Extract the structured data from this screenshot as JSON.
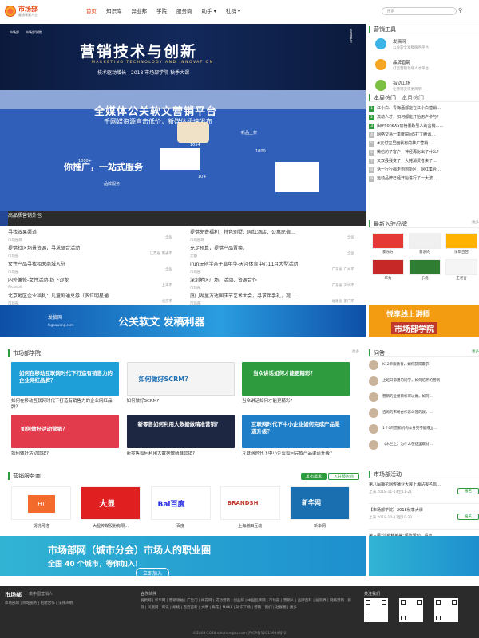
{
  "header": {
    "logo_main": "市场部",
    "logo_sub": "營銷專業人士",
    "tagline": "做中国",
    "nav": [
      "首页",
      "知识库",
      "异业邦",
      "学院",
      "服务商",
      "助手 ▾",
      "社群 ▾"
    ],
    "search_placeholder": "搜索",
    "search_icon": "search-icon"
  },
  "hero": {
    "title": "营销技术与创新",
    "subtitle": "MARKETING TECHNOLOGY AND INNOVATION",
    "line": "技术驱动增长　2018 市场部学院 秋季大课",
    "badge_left": "市场部",
    "badge_left2": "市场部学院",
    "badge_right": "市场部学院"
  },
  "slider": {
    "headline": "全媒体公关软文营销平台",
    "sub": "千网媒资源直击低价，新媒体极速发布",
    "headline2": "你推广，一站式服务",
    "footer": "高品质营销外包",
    "labels": [
      "1000+",
      "1054",
      "1000",
      "新品上架",
      "10+",
      "品牌服务"
    ]
  },
  "news": [
    {
      "t": "寻找效果渠道",
      "m": "市场部网",
      "p": "全国",
      "t2": "提供免费福利：特色别墅、网红酒店、公寓民宿…",
      "m2": "市场部网",
      "p2": "全国"
    },
    {
      "t": "提供社区场景资源，寻求联合活动",
      "m": "市场部",
      "p": "江苏省 南通市",
      "t2": "充足预算，提供产品置换。",
      "m2": "大都",
      "p2": "全国"
    },
    {
      "t": "女性产品寻找相关商城入驻",
      "m": "市场部",
      "p": "全国",
      "t2": "ifun玩创学亲子嘉年华-天河体育中心11月大型活动",
      "m2": "市场部",
      "p2": "广东省 广州市"
    },
    {
      "t": "内外兼修-女性活动-线下沙龙",
      "m": "Ricosoft",
      "p": "上海市",
      "t2": "深圳地区广场、活动、资源合作",
      "m2": "市场部",
      "p2": "广东省 深圳市"
    },
    {
      "t": "北京地区企业福利：儿童剧通兑券（多位明星通…",
      "m": "市场部",
      "p": "北京市",
      "t2": "厦门湖里方达国庆节艺术大会，寻求伴手礼，提…",
      "m2": "市场部",
      "p2": "福建省 厦门市"
    }
  ],
  "banner1": {
    "logo": "发稿网",
    "logo_url": "fagaowang.com",
    "text": "公关软文 发稿利器"
  },
  "academy": {
    "title": "市场部学院",
    "more": "更多",
    "items": [
      {
        "img": "如何在移动互联网时代下打造有销售力的企业网红品牌？",
        "t": "如何在移动互联网时代下打造有销售力的企业网红品牌？"
      },
      {
        "img": "如何做好SCRM？",
        "t": "如何做好SCRM?"
      },
      {
        "img": "当众讲话如何才能更精彩？",
        "t": "当众讲话如何才能更精彩?"
      },
      {
        "img": "如何做好活动营销？",
        "t": "如何做好活动营销?"
      },
      {
        "img": "新零售如何利用大数据做精准营销？",
        "t": "新零售如何利用大数据做精准营销?"
      },
      {
        "img": "互联网时代下中小企业如何完成产品渠道升级？",
        "t": "互联网时代下中小企业如何完成产品渠道升级?"
      }
    ]
  },
  "services": {
    "title": "营销服务商",
    "btn1": "发布需求",
    "btn2": "入驻服务商",
    "items": [
      {
        "n": "胡桃网络",
        "logo": "HT"
      },
      {
        "n": "大显传媒股份有限…",
        "logo": "大显"
      },
      {
        "n": "百度",
        "logo": "Bai百度"
      },
      {
        "n": "上海增田互动",
        "logo": "BRANDSH"
      },
      {
        "n": "新华网",
        "logo": "新华网"
      }
    ]
  },
  "banner2": {
    "title": "市场部网（城市分会）市场人的职业圈",
    "sub": "全国 40 个城市，等你加入！",
    "join": "立即加入"
  },
  "right": {
    "tools_title": "营销工具",
    "tools": [
      {
        "n": "发稿网",
        "d": "公关软文发稿服务平台",
        "c": "#3cb4e8"
      },
      {
        "n": "品牌直聘",
        "d": "打造营销领域人才平台",
        "c": "#f5a623"
      },
      {
        "n": "指动工场",
        "d": "让营销变得更简单",
        "c": "#7bc043"
      }
    ],
    "hot_tabs": [
      "本周热门",
      "本月热门"
    ],
    "hot": [
      {
        "n": "1",
        "t": "江小白、青梅酒都能在江小白营销…"
      },
      {
        "n": "2",
        "t": "流动人才，如何都能开始用户参与？"
      },
      {
        "n": "3",
        "t": "由iPhoneXS价格暴跌引人的营销……"
      },
      {
        "n": "4",
        "t": "网络交易一季度瞬间5打了腾讯…"
      },
      {
        "n": "5",
        "t": "#支付宝里面就有的推广营销…"
      },
      {
        "n": "6",
        "t": "微信的了客户，神经再比出了什么？"
      },
      {
        "n": "7",
        "t": "又双叒叕变了！大摊消费者来了…"
      },
      {
        "n": "8",
        "t": "话一行行都走到到新区：网红集合…"
      },
      {
        "n": "9",
        "t": "运动品牌已经开始进行了一大波…"
      }
    ],
    "partners_title": "最新入驻品牌",
    "more": "更多",
    "partners": [
      "新东方",
      "新浪的",
      "深圳百合",
      "华为",
      "乐视",
      "王老吉",
      "德克士",
      "CITEEN",
      "LEFIT",
      "小猪侠",
      "HICP",
      "真品牌"
    ],
    "promo": {
      "t1": "悦享线上讲师",
      "t2": "市场部学院"
    },
    "qa_title": "问答",
    "qa": [
      "K12单跟教育，如何获得需求",
      "上班日常用的同学，如何培养的营销",
      "营销的业绩目标可以做，如何…",
      "咨询的市场合作怎么签的就，…",
      "1个0的营销机构本身完不能成立…",
      "《木兰之》为什么在这里取材…",
      "求K12教育市场招商…"
    ],
    "ev_title": "市场部活动",
    "events": [
      {
        "t": "第八届梅花网传播业大展上海站报名启…",
        "d": "上海 2018-11-14至11-21",
        "b": "报名"
      },
      {
        "t": "【市场部学院】2018秋季大课",
        "d": "上海 2018-10-13至10-30",
        "b": "报名"
      },
      {
        "t": "第三届\"营销精英荟\"评选活动，看市…",
        "d": "上海 2018-08-01至09-30",
        "b": "报名"
      }
    ]
  },
  "footer": {
    "logo": "市场部",
    "logo_sub": "做中国营销人",
    "links": "关于我们 | 联系我们 | 免责声明",
    "links2": "市场部网 | 网站服务 | 招聘合作 | 法律声明",
    "partner_title": "合作伙伴",
    "partners": "发稿网 | 新华网 | 营销领袖 | 广告门 | 梅花网 | 成功营销 | 创业邦 | 中国品牌网 | 市场部 | 营销人 | 品牌百科 | 投资界 | 网络营销 | 新浪 | 凤凰网 | 和讯 | 胡桃 | 百度百科 | 大摩 | 梅花 | MAKA | 知识工场 | 营销 | 我们 | 社群圈 | 更多",
    "follow": "关注我们",
    "copyright": "©2008-2018 shichangbu.com 沪ICP备12015944号-2"
  }
}
